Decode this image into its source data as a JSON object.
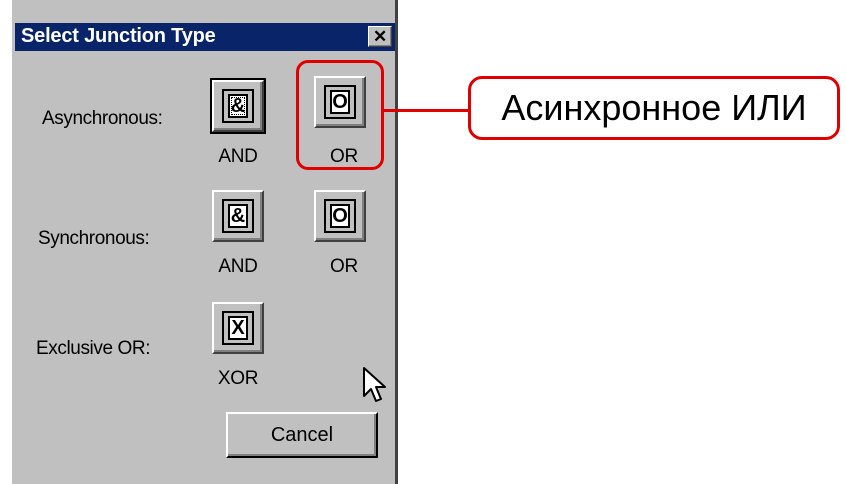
{
  "dialog": {
    "title": "Select Junction Type",
    "close_icon": "close-icon",
    "rows": {
      "asynchronous": {
        "label": "Asynchronous:",
        "and": {
          "symbol": "&",
          "caption": "AND"
        },
        "or": {
          "symbol": "O",
          "caption": "OR"
        }
      },
      "synchronous": {
        "label": "Synchronous:",
        "and": {
          "symbol": "&",
          "caption": "AND"
        },
        "or": {
          "symbol": "O",
          "caption": "OR"
        }
      },
      "exclusive": {
        "label": "Exclusive OR:",
        "xor": {
          "symbol": "X",
          "caption": "XOR"
        }
      }
    },
    "cancel_label": "Cancel"
  },
  "annotation": {
    "callout_text": "Асинхронное ИЛИ",
    "color": "#e00000"
  },
  "colors": {
    "dialog_bg": "#c0c0c0",
    "titlebar_bg": "#0a246a",
    "titlebar_text": "#ffffff"
  }
}
